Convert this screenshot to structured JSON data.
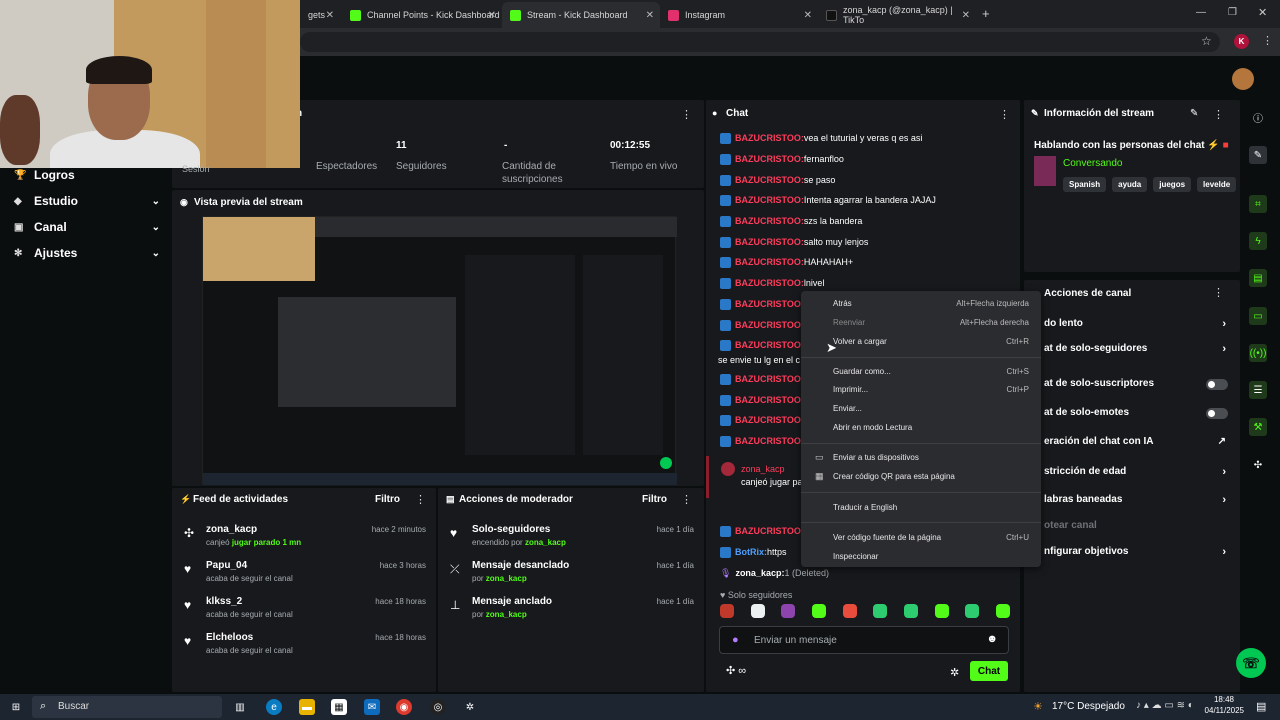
{
  "browser": {
    "tabs": [
      {
        "label": "gets",
        "x_close": "✕"
      },
      {
        "label": "Channel Points - Kick Dashboard",
        "x_close": "✕"
      },
      {
        "label": "Stream - Kick Dashboard",
        "x_close": "✕"
      },
      {
        "label": "Instagram",
        "x_close": "✕"
      },
      {
        "label": "zona_kacp (@zona_kacp) | TikTo",
        "x_close": "✕"
      }
    ],
    "new_tab": "+",
    "profile_initial": "K"
  },
  "sidebar": {
    "partial_label": "Sesión",
    "items": [
      {
        "label": "Logros"
      },
      {
        "label": "Estudio"
      },
      {
        "label": "Canal"
      },
      {
        "label": "Ajustes"
      }
    ]
  },
  "stats": {
    "header_partial": "n",
    "items": [
      {
        "value": "",
        "label": "Espectadores"
      },
      {
        "value": "11",
        "label": "Seguidores"
      },
      {
        "value": "-",
        "label": "Cantidad de suscripciones"
      },
      {
        "value": "00:12:55",
        "label": "Tiempo en vivo"
      }
    ]
  },
  "preview": {
    "title": "Vista previa del stream"
  },
  "activity_feed": {
    "title": "Feed de actividades",
    "filter": "Filtro",
    "items": [
      {
        "name": "zona_kacp",
        "sub": "canjeó",
        "highlight": "jugar parado 1 mn",
        "time": "hace 2 minutos"
      },
      {
        "name": "Papu_04",
        "sub": "acaba de seguir el canal",
        "highlight": "",
        "time": "hace 3 horas"
      },
      {
        "name": "klkss_2",
        "sub": "acaba de seguir el canal",
        "highlight": "",
        "time": "hace 18 horas"
      },
      {
        "name": "Elcheloos",
        "sub": "acaba de seguir el canal",
        "highlight": "",
        "time": "hace 18 horas"
      }
    ]
  },
  "mod_actions": {
    "title": "Acciones de moderador",
    "filter": "Filtro",
    "items": [
      {
        "name": "Solo-seguidores",
        "sub": "encendido por",
        "by": "zona_kacp",
        "time": "hace 1 día"
      },
      {
        "name": "Mensaje desanclado",
        "sub": "por",
        "by": "zona_kacp",
        "time": "hace 1 día"
      },
      {
        "name": "Mensaje anclado",
        "sub": "por",
        "by": "zona_kacp",
        "time": "hace 1 día"
      }
    ]
  },
  "chat": {
    "title": "Chat",
    "messages": [
      {
        "user": "BAZUCRISTOO:",
        "text": " vea el tuturial y veras q es asi"
      },
      {
        "user": "BAZUCRISTOO:",
        "text": " fernanfloo"
      },
      {
        "user": "BAZUCRISTOO:",
        "text": " se paso"
      },
      {
        "user": "BAZUCRISTOO:",
        "text": " Intenta agarrar la bandera JAJAJ"
      },
      {
        "user": "BAZUCRISTOO:",
        "text": " szs la bandera"
      },
      {
        "user": "BAZUCRISTOO:",
        "text": " salto muy lenjos"
      },
      {
        "user": "BAZUCRISTOO:",
        "text": " HAHAHAH+"
      },
      {
        "user": "BAZUCRISTOO:",
        "text": " lnivel"
      },
      {
        "user": "BAZUCRISTOO:",
        "text": ""
      },
      {
        "user": "BAZUCRISTOO:",
        "text": ""
      },
      {
        "user": "BAZUCRISTOO:",
        "text": ""
      }
    ],
    "wrapped_line": "se envie tu lg en el c",
    "more_messages": [
      {
        "user": "BAZUCRISTOO:",
        "text": ""
      },
      {
        "user": "BAZUCRISTOO:",
        "text": ""
      },
      {
        "user": "BAZUCRISTOO:",
        "text": ""
      },
      {
        "user": "BAZUCRISTOO:",
        "text": ""
      }
    ],
    "redeem": {
      "user": "zona_kacp",
      "text": "canjeó jugar pa"
    },
    "after_redeem": [
      {
        "user": "BAZUCRISTOO:",
        "text": ""
      },
      {
        "user": "BotRix:",
        "text": " https"
      }
    ],
    "pinned": {
      "user": "zona_kacp:",
      "text": " 1 (Deleted)"
    },
    "mode_label": "Solo seguidores",
    "input_placeholder": "Enviar un mensaje",
    "send_label": "Chat",
    "emote_icons": [
      "cat-emote-icon",
      "robot-emote-icon",
      "grid-emote-icon",
      "kick-emote-icon",
      "box-emote-icon",
      "globe-emote-icon",
      "chat-emote-icon",
      "green-emote-icon",
      "smile-emote-icon",
      "bubble-emote-icon"
    ]
  },
  "stream_info": {
    "title": "Información del stream",
    "stream_title": "Hablando con las personas del chat ⚡",
    "category": "Conversando",
    "tags": [
      "Spanish",
      "ayuda",
      "juegos",
      "levelde"
    ]
  },
  "channel_actions": {
    "title": "Acciones de canal",
    "items": [
      {
        "label": "do lento",
        "control": "chevron"
      },
      {
        "label": "at de solo-seguidores",
        "control": "chevron"
      },
      {
        "label": "at de solo-suscriptores",
        "control": "toggle"
      },
      {
        "label": "at de solo-emotes",
        "control": "toggle"
      },
      {
        "label": "eración del chat con IA",
        "control": "external"
      },
      {
        "label": "stricción de edad",
        "control": "chevron"
      },
      {
        "label": "labras baneadas",
        "control": "chevron"
      },
      {
        "label": "otear canal",
        "control": "disabled"
      },
      {
        "label": "nfigurar objetivos",
        "control": "chevron"
      }
    ]
  },
  "context_menu": {
    "items": [
      {
        "label": "Atrás",
        "shortcut": "Alt+Flecha izquierda",
        "disabled": false
      },
      {
        "label": "Reenviar",
        "shortcut": "Alt+Flecha derecha",
        "disabled": true
      },
      {
        "label": "Volver a cargar",
        "shortcut": "Ctrl+R",
        "disabled": false
      },
      {
        "label": "Guardar como...",
        "shortcut": "Ctrl+S",
        "disabled": false
      },
      {
        "label": "Imprimir...",
        "shortcut": "Ctrl+P",
        "disabled": false
      },
      {
        "label": "Enviar...",
        "shortcut": "",
        "disabled": false
      },
      {
        "label": "Abrir en modo Lectura",
        "shortcut": "",
        "disabled": false
      },
      {
        "label": "Enviar a tus dispositivos",
        "shortcut": "",
        "disabled": false
      },
      {
        "label": "Crear código QR para esta página",
        "shortcut": "",
        "disabled": false
      },
      {
        "label": "Traducir a English",
        "shortcut": "",
        "disabled": false
      },
      {
        "label": "Ver código fuente de la página",
        "shortcut": "Ctrl+U",
        "disabled": false
      },
      {
        "label": "Inspeccionar",
        "shortcut": "",
        "disabled": false
      }
    ]
  },
  "taskbar": {
    "search_placeholder": "Buscar",
    "weather": "17°C Despejado",
    "time": "18:48",
    "date": "04/11/2025"
  },
  "colors": {
    "accent": "#53fc18",
    "danger": "#ff3c5c",
    "panel": "#17191c"
  }
}
